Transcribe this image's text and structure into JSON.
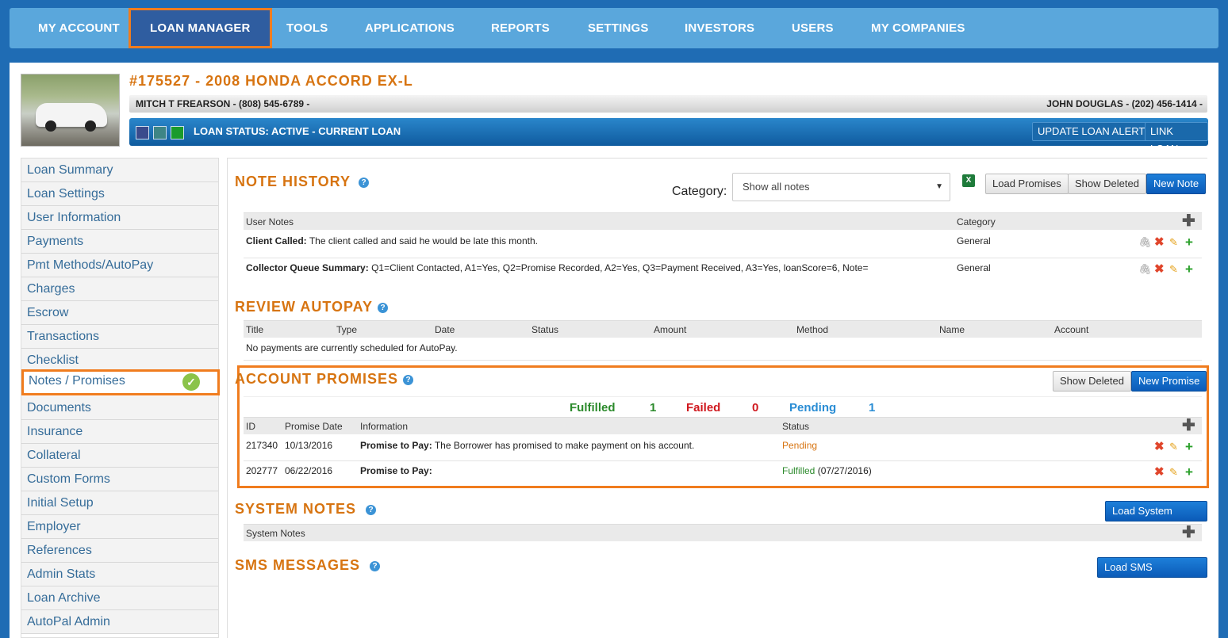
{
  "nav": {
    "items": [
      "MY ACCOUNT",
      "LOAN MANAGER",
      "TOOLS",
      "APPLICATIONS",
      "REPORTS",
      "SETTINGS",
      "INVESTORS",
      "USERS",
      "MY COMPANIES"
    ],
    "active_index": 1
  },
  "loan": {
    "title": "#175527 - 2008 HONDA ACCORD EX-L",
    "borrower": "MITCH T FREARSON - (808) 545-6789 -",
    "collector": "JOHN DOUGLAS - (202) 456-1414 -",
    "status": "LOAN STATUS: ACTIVE - CURRENT LOAN",
    "status_colors": [
      "#3a4b8c",
      "#3e8585",
      "#1a9b2b"
    ],
    "update_alert_label": "UPDATE LOAN ALERT",
    "link_loan_label": "LINK LOAN"
  },
  "sidebar": {
    "items": [
      "Loan Summary",
      "Loan Settings",
      "User Information",
      "Payments",
      "Pmt Methods/AutoPay",
      "Charges",
      "Escrow",
      "Transactions",
      "Checklist",
      "Notes / Promises",
      "Documents",
      "Insurance",
      "Collateral",
      "Custom Forms",
      "Initial Setup",
      "Employer",
      "References",
      "Admin Stats",
      "Loan Archive",
      "AutoPal Admin"
    ],
    "active_index": 9
  },
  "note_history": {
    "title": "NOTE HISTORY",
    "category_label": "Category:",
    "category_value": "Show all notes",
    "load_promises": "Load Promises",
    "show_deleted": "Show Deleted",
    "new_note": "New Note",
    "columns": [
      "User Notes",
      "Category"
    ],
    "rows": [
      {
        "label": "Client Called:",
        "text": "The client called and said he would be late this month.",
        "category": "General"
      },
      {
        "label": "Collector Queue Summary:",
        "text": "Q1=Client Contacted, A1=Yes, Q2=Promise Recorded, A2=Yes, Q3=Payment Received, A3=Yes, loanScore=6, Note=",
        "category": "General"
      }
    ]
  },
  "review_autopay": {
    "title": "REVIEW AUTOPAY",
    "columns": [
      "Title",
      "Type",
      "Date",
      "Status",
      "Amount",
      "Method",
      "Name",
      "Account"
    ],
    "empty": "No payments are currently scheduled for AutoPay."
  },
  "account_promises": {
    "title": "ACCOUNT PROMISES",
    "show_deleted": "Show Deleted",
    "new_promise": "New Promise",
    "stats": {
      "fulfilled_label": "Fulfilled",
      "fulfilled": "1",
      "failed_label": "Failed",
      "failed": "0",
      "pending_label": "Pending",
      "pending": "1"
    },
    "columns": [
      "ID",
      "Promise Date",
      "Information",
      "Status"
    ],
    "rows": [
      {
        "id": "217340",
        "date": "10/13/2016",
        "label": "Promise to Pay:",
        "text": "The Borrower has promised to make payment on his account.",
        "status": "Pending",
        "status_extra": ""
      },
      {
        "id": "202777",
        "date": "06/22/2016",
        "label": "Promise to Pay:",
        "text": "",
        "status": "Fulfilled",
        "status_extra": "(07/27/2016)"
      }
    ]
  },
  "system_notes": {
    "title": "SYSTEM NOTES",
    "load_button": "Load System Notes",
    "column": "System Notes"
  },
  "sms_messages": {
    "title": "SMS MESSAGES",
    "load_button": "Load SMS Messages"
  },
  "colors": {
    "accent": "#d77411",
    "highlight": "#f07c1e",
    "fulfilled": "#2b8a2b",
    "failed": "#d0181e",
    "pending": "#2a8dd4"
  }
}
